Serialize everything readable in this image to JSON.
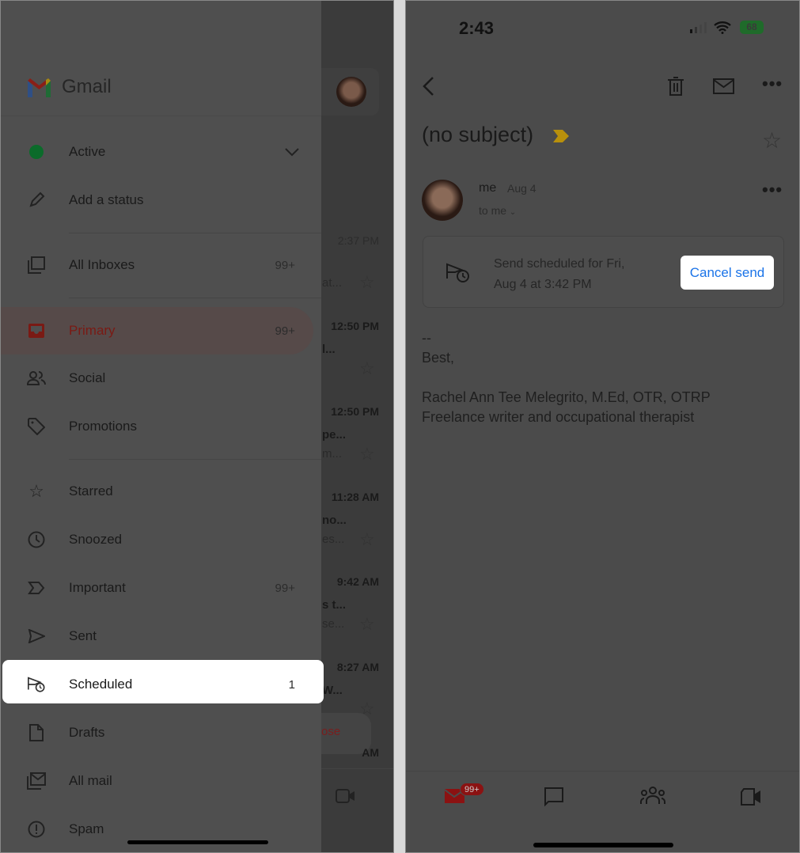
{
  "left": {
    "app_name": "Gmail",
    "status": {
      "label": "Active",
      "add_status": "Add a status",
      "status_color": "#0b6b2a"
    },
    "items": [
      {
        "label": "All Inboxes",
        "count": "99+",
        "icon": "all-inboxes-icon"
      },
      {
        "label": "Primary",
        "count": "99+",
        "icon": "inbox-icon",
        "selected": true
      },
      {
        "label": "Social",
        "count": "",
        "icon": "people-icon"
      },
      {
        "label": "Promotions",
        "count": "",
        "icon": "tag-icon"
      },
      {
        "label": "Starred",
        "count": "",
        "icon": "star-icon"
      },
      {
        "label": "Snoozed",
        "count": "",
        "icon": "clock-icon"
      },
      {
        "label": "Important",
        "count": "99+",
        "icon": "important-icon"
      },
      {
        "label": "Sent",
        "count": "",
        "icon": "send-icon"
      },
      {
        "label": "Scheduled",
        "count": "1",
        "icon": "scheduled-send-icon",
        "highlighted": true
      },
      {
        "label": "Drafts",
        "count": "",
        "icon": "draft-icon"
      },
      {
        "label": "All mail",
        "count": "",
        "icon": "all-mail-icon"
      },
      {
        "label": "Spam",
        "count": "",
        "icon": "spam-icon"
      }
    ],
    "background_list": {
      "times": [
        "2:37 PM",
        "12:50 PM",
        "12:50 PM",
        "11:28 AM",
        "9:42 AM",
        "8:27 AM"
      ],
      "snippets": [
        "at...",
        "l...",
        "",
        "pe...",
        "m...",
        "no...",
        "es...",
        "s t...",
        "se...",
        "W...",
        ""
      ],
      "compose_label": "ose",
      "last_time": "AM"
    }
  },
  "right": {
    "status_bar": {
      "time": "2:43",
      "battery": "68"
    },
    "subject": "(no subject)",
    "sender": {
      "name": "me",
      "date": "Aug 4",
      "recipient": "to me"
    },
    "schedule_card": {
      "line1": "Send scheduled for Fri,",
      "line2": "Aug 4 at 3:42 PM",
      "cancel_label": "Cancel send"
    },
    "body": [
      "--",
      "Best,",
      "",
      "Rachel Ann Tee Melegrito, M.Ed, OTR, OTRP",
      "Freelance writer and occupational therapist"
    ],
    "nav": {
      "mail_badge": "99+"
    },
    "colors": {
      "accent": "#1a73e8",
      "badge": "#8b1212",
      "important": "#b8900c"
    }
  }
}
